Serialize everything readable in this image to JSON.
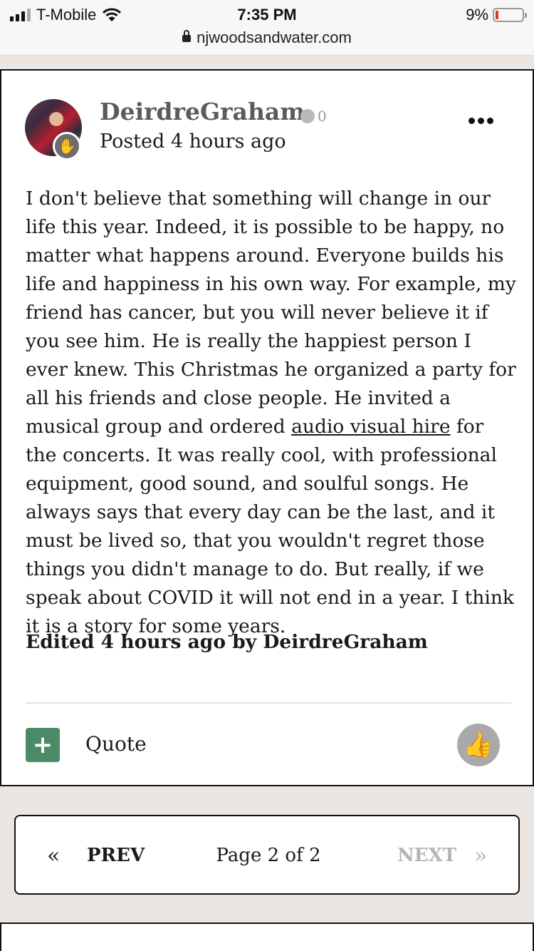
{
  "status_bar": {
    "carrier": "T-Mobile",
    "time": "7:35 PM",
    "battery_percent": "9%",
    "battery_level": 0.09,
    "url": "njwoodsandwater.com"
  },
  "post": {
    "username": "DeirdreGraham",
    "reputation": "0",
    "posted": "Posted 4 hours ago",
    "body_before_link": "I don't believe that something will change in our life this year. Indeed, it is possible to be happy, no matter what happens around. Everyone builds his life and happiness in his own way. For example, my friend has cancer, but you will never believe it if you see him. He is really the happiest person I ever knew. This Christmas he organized a party for all his friends and close people. He invited a musical group and ordered ",
    "link_text": "audio visual hire",
    "body_after_link": " for the concerts. It was really cool, with professional equipment, good sound, and soulful songs. He always says that every day can be the last, and it must be lived so, that you wouldn't regret those things you didn't manage to do. But really, if we speak about COVID it will not end in a year. I think it is a story for some years.",
    "edited": "Edited 4 hours ago by DeirdreGraham",
    "plus_label": "+",
    "quote_label": "Quote"
  },
  "pagination": {
    "first_symbol": "«",
    "prev_label": "PREV",
    "page_label": "Page 2 of 2",
    "next_label": "NEXT",
    "last_symbol": "»"
  },
  "icons": {
    "avatar_badge": "hand-icon",
    "like": "thumbs-up-icon",
    "menu": "more-options-icon"
  },
  "colors": {
    "plus_button": "#4b8a66",
    "like_button": "#a9a9a9",
    "disabled_text": "#b5b5b5"
  }
}
